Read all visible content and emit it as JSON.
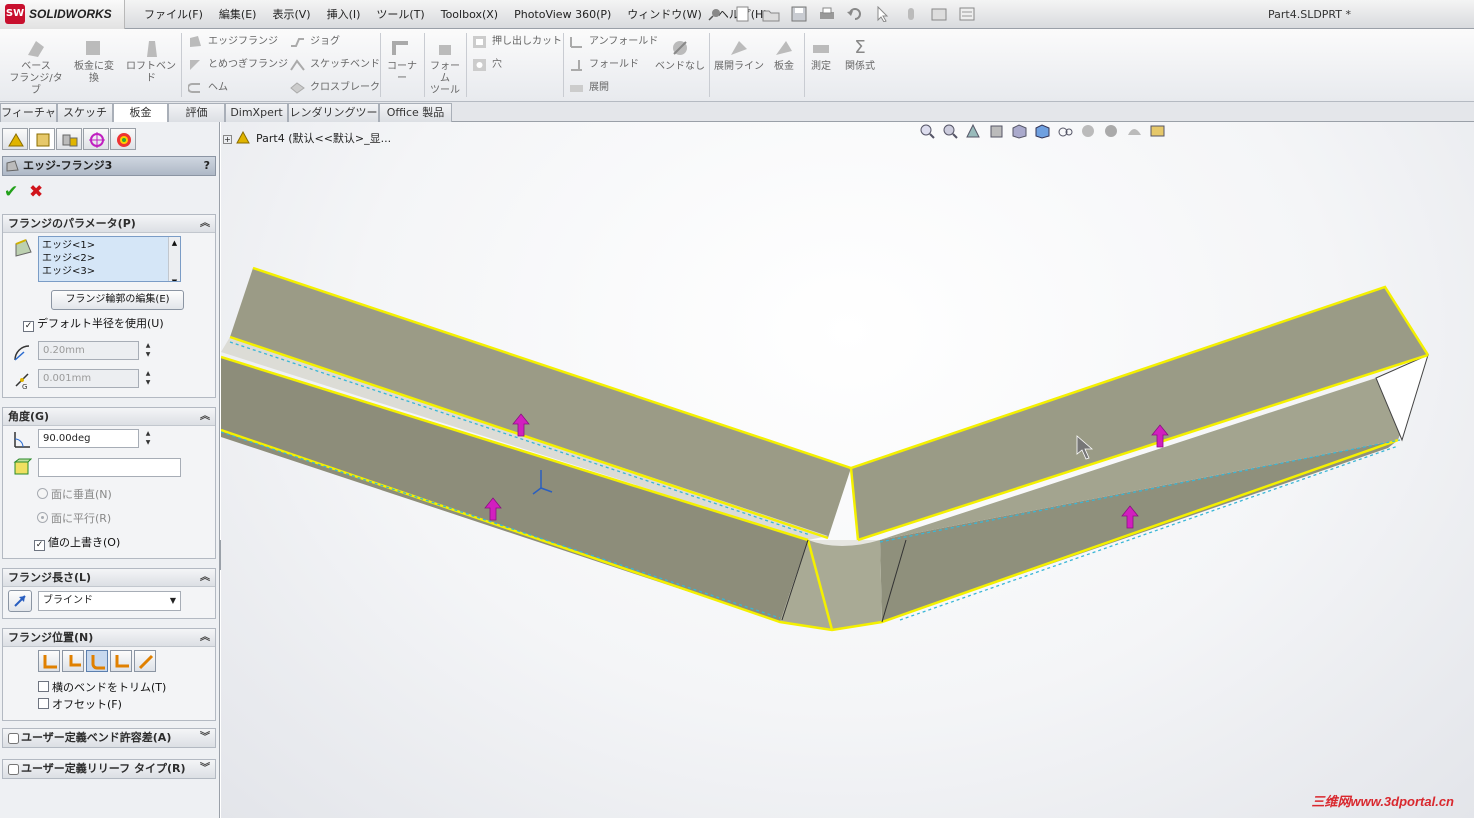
{
  "app": {
    "brand": "SOLIDWORKS",
    "brand_mark": "SW",
    "document_title": "Part4.SLDPRT *"
  },
  "menu": [
    "ファイル(F)",
    "編集(E)",
    "表示(V)",
    "挿入(I)",
    "ツール(T)",
    "Toolbox(X)",
    "PhotoView 360(P)",
    "ウィンドウ(W)",
    "ヘルプ(H)"
  ],
  "ribbon": {
    "base_flange": "ベース\nフランジ/タブ",
    "convert_to_sheet": "板金に変\n換",
    "lofted_bend": "ロフトベンド",
    "edge_flange": "エッジフランジ",
    "miter_flange": "とめつぎフランジ",
    "hem": "ヘム",
    "jog": "ジョグ",
    "sketched_bend": "スケッチベンド",
    "cross_break": "クロスブレーク",
    "corners": "コーナー",
    "forming_tool": "フォーム\nツール",
    "extruded_cut": "押し出しカット",
    "hole": "穴",
    "unfold": "アンフォールド",
    "fold": "フォールド",
    "flatten": "展開",
    "no_bends": "ベンドなし",
    "flatten_lines": "展開ライン",
    "sheet_metal": "板金",
    "measure": "測定",
    "equations": "関係式"
  },
  "tabs": [
    "フィーチャー",
    "スケッチ",
    "板金",
    "評価",
    "DimXpert",
    "レンダリングツール",
    "Office 製品"
  ],
  "active_tab": "板金",
  "property_manager": {
    "title": "エッジ-フランジ3",
    "help": "?",
    "ok": "✔",
    "cancel": "✖",
    "flange_params": {
      "header": "フランジのパラメータ(P)",
      "edges": [
        "エッジ<1>",
        "エッジ<2>",
        "エッジ<3>"
      ],
      "edit_profile_button": "フランジ輪郭の編集(E)",
      "use_default_radius": "デフォルト半径を使用(U)",
      "radius_value": "0.20mm",
      "gap_value": "0.001mm"
    },
    "angle": {
      "header": "角度(G)",
      "angle_value": "90.00deg",
      "reference_face": "",
      "normal_to_face": "面に垂直(N)",
      "parallel_to_face": "面に平行(R)",
      "override_value": "値の上書き(O)"
    },
    "flange_length": {
      "header": "フランジ長さ(L)",
      "end_condition": "ブラインド"
    },
    "flange_position": {
      "header": "フランジ位置(N)",
      "trim_side_bends": "横のベンドをトリム(T)",
      "offset": "オフセット(F)"
    },
    "custom_bend_allowance": {
      "header": "ユーザー定義ベンド許容差(A)"
    },
    "custom_relief_type": {
      "header": "ユーザー定義リリーフ タイプ(R)"
    }
  },
  "tree": {
    "root_label": "Part4  (默认<<默认>_显..."
  },
  "watermark": "三维网www.3dportal.cn",
  "colors": {
    "highlight_edge": "#f4f000",
    "part_face": "#9a9a84",
    "part_face_light": "#b2b3a0",
    "arrow": "#d21fbf",
    "ok": "#23a11a",
    "cancel": "#d0141b"
  }
}
